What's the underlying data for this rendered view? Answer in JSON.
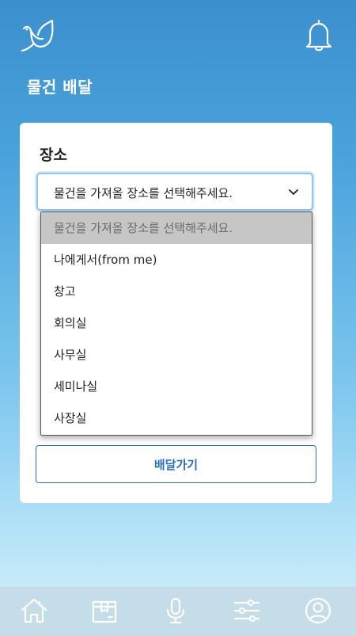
{
  "header": {
    "logo_icon": "bird-leaf-logo-icon",
    "notification_icon": "bell-icon"
  },
  "page": {
    "title": "물건 배달"
  },
  "form": {
    "location_label": "장소",
    "location_select": {
      "selected_value": "물건을 가져올 장소를 선택해주세요.",
      "options": [
        "물건을 가져올 장소를 선택해주세요.",
        "나에게서(from me)",
        "창고",
        "회의실",
        "사무실",
        "세미나실",
        "사장실"
      ]
    },
    "submit_label": "배달가기"
  },
  "tabbar": {
    "items": [
      {
        "icon": "home-icon"
      },
      {
        "icon": "package-icon"
      },
      {
        "icon": "microphone-icon"
      },
      {
        "icon": "sliders-icon"
      },
      {
        "icon": "user-icon"
      }
    ]
  },
  "colors": {
    "accent": "#2a70b0",
    "gradient_top": "#3b8fcd",
    "gradient_bottom": "#d6f0fb"
  }
}
